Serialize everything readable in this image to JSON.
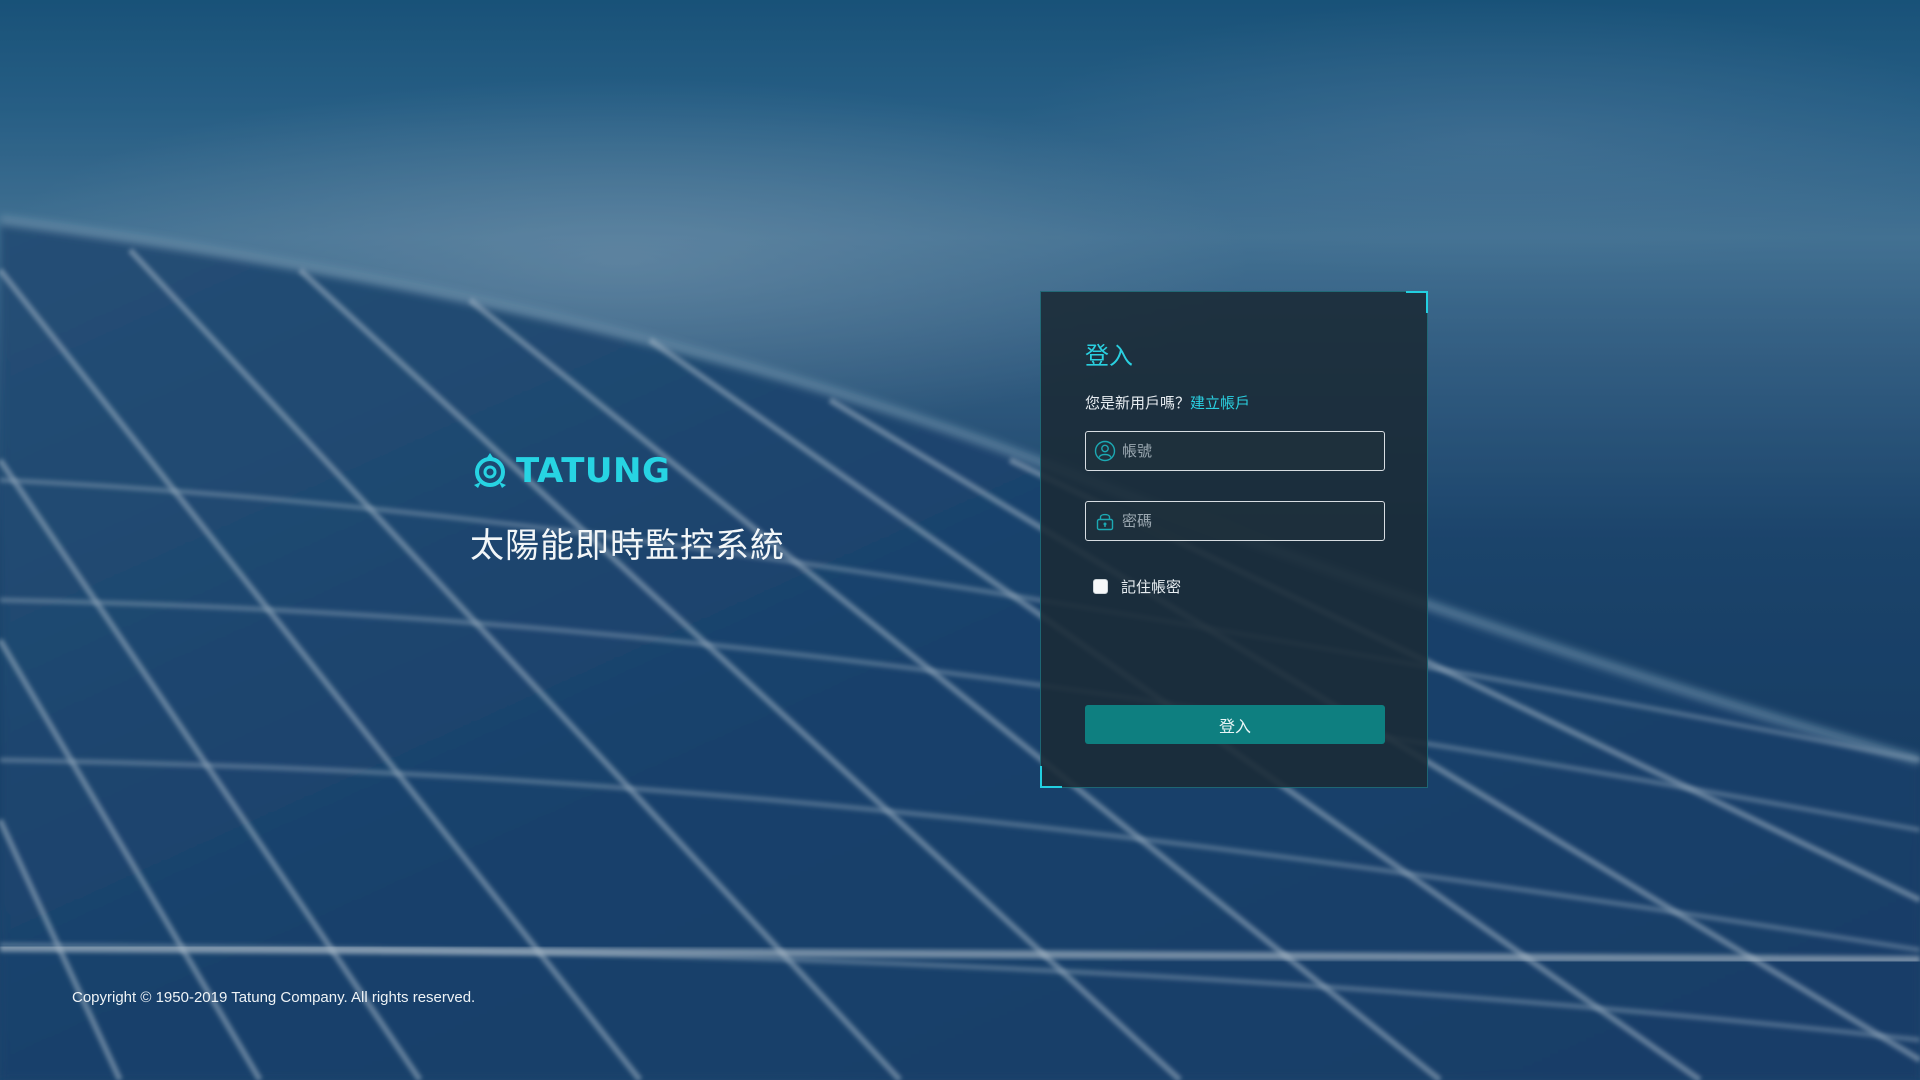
{
  "brand": {
    "logo_text": "TATUNG",
    "system_title": "太陽能即時監控系統",
    "accent_color": "#27d4e3"
  },
  "login": {
    "title": "登入",
    "signup_prompt": "您是新用戶嗎？",
    "signup_link": "建立帳戶",
    "username_placeholder": "帳號",
    "password_placeholder": "密碼",
    "remember_label": "記住帳密",
    "remember_checked": false,
    "submit_label": "登入",
    "button_color": "#0e7f80",
    "icons": {
      "username": "user-icon",
      "password": "lock-icon"
    }
  },
  "footer": {
    "copyright": "Copyright © 1950-2019 Tatung Company. All rights reserved."
  }
}
